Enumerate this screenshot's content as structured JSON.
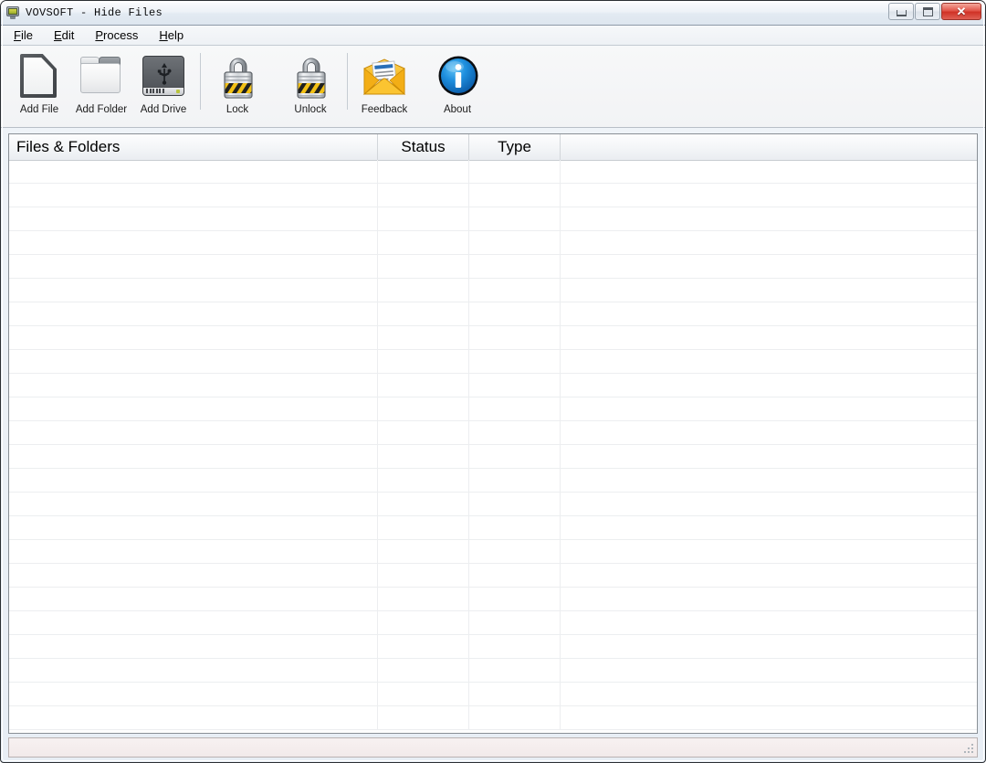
{
  "window": {
    "title": "VOVSOFT - Hide Files",
    "app_icon": "monitor-icon",
    "controls": {
      "minimize": "minimize-icon",
      "maximize": "maximize-icon",
      "close": "✕"
    }
  },
  "menubar": {
    "items": [
      {
        "accesskey": "F",
        "rest": "ile"
      },
      {
        "accesskey": "E",
        "rest": "dit"
      },
      {
        "accesskey": "P",
        "rest": "rocess"
      },
      {
        "accesskey": "H",
        "rest": "elp"
      }
    ]
  },
  "toolbar": {
    "buttons": [
      {
        "label": "Add File",
        "icon": "document-icon"
      },
      {
        "label": "Add Folder",
        "icon": "folder-icon"
      },
      {
        "label": "Add Drive",
        "icon": "usb-drive-icon"
      },
      {
        "label": "Lock",
        "icon": "padlock-closed-icon"
      },
      {
        "label": "Unlock",
        "icon": "padlock-open-icon"
      },
      {
        "label": "Feedback",
        "icon": "envelope-icon"
      },
      {
        "label": "About",
        "icon": "info-circle-icon"
      }
    ]
  },
  "list": {
    "columns": [
      "Files & Folders",
      "Status",
      "Type",
      ""
    ],
    "rows": [],
    "empty_row_count": 24
  },
  "statusbar": {
    "text": ""
  },
  "colors": {
    "accent_blue": "#1a7fd4",
    "lock_yellow": "#f2c014",
    "envelope_yellow": "#f5b721",
    "titlebar": "#eef2f7",
    "window_bg": "#f0f4f8"
  }
}
